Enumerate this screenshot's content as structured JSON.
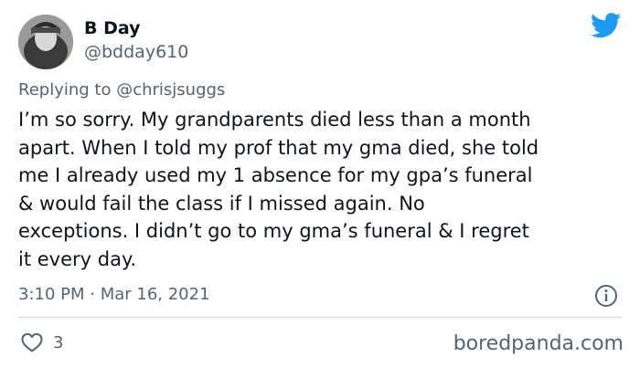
{
  "author": {
    "display_name": "B Day",
    "handle": "@bdday610"
  },
  "reply": {
    "prefix": "Replying to ",
    "mention": "@chrisjsuggs"
  },
  "tweet": {
    "text": "I’m so sorry. My grandparents died less than a month\napart. When I told my prof that my gma died, she told\nme I already used my 1 absence for my gpa’s funeral\n& would fail the class if I missed again. No\nexceptions. I didn’t go to my gma’s funeral & I regret\nit every day.",
    "timestamp": "3:10 PM · Mar 16, 2021"
  },
  "engagement": {
    "likes": "3"
  },
  "watermark": "boredpanda.com",
  "icons": {
    "brand": "twitter-bird-icon",
    "info": "info-icon",
    "like": "heart-icon"
  },
  "colors": {
    "twitter_blue": "#1d9bf0",
    "secondary_text": "#536471",
    "primary_text": "#0f1419",
    "divider": "#cfd9de"
  }
}
